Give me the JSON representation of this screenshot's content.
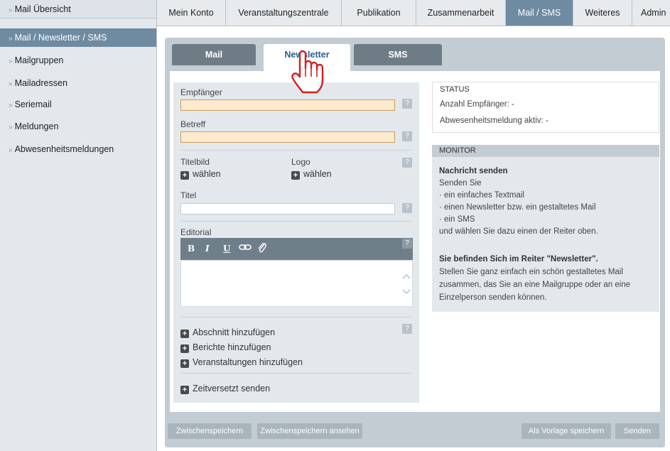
{
  "sidebar": {
    "items": [
      {
        "label": "Mail Übersicht"
      },
      {
        "label": "Mail / Newsletter / SMS"
      },
      {
        "label": "Mailgruppen"
      },
      {
        "label": "Mailadressen"
      },
      {
        "label": "Seriemail"
      },
      {
        "label": "Meldungen"
      },
      {
        "label": "Abwesenheitsmeldungen"
      }
    ],
    "chevron": "»"
  },
  "topnav": {
    "tabs": [
      {
        "label": "Mein Konto"
      },
      {
        "label": "Veranstaltungszentrale"
      },
      {
        "label": "Publikation"
      },
      {
        "label": "Zusammenarbeit"
      },
      {
        "label": "Mail / SMS"
      },
      {
        "label": "Weiteres"
      },
      {
        "label": "Admin"
      }
    ],
    "active": "Mail / SMS"
  },
  "subtabs": [
    {
      "label": "Mail"
    },
    {
      "label": "Newsletter"
    },
    {
      "label": "SMS"
    }
  ],
  "form": {
    "empfaenger_label": "Empfänger",
    "betreff_label": "Betreff",
    "titelbild_label": "Titelbild",
    "logo_label": "Logo",
    "waehlen": "wählen",
    "titel_label": "Titel",
    "editorial_label": "Editorial",
    "help": "?",
    "editor_tools": [
      "B",
      "I",
      "U"
    ],
    "add_items": [
      {
        "label": "Abschnitt hinzufügen"
      },
      {
        "label": "Berichte hinzufügen"
      },
      {
        "label": "Veranstaltungen hinzufügen"
      }
    ],
    "zeitversetzt": "Zeitversetzt senden"
  },
  "status": {
    "title": "STATUS",
    "lines": [
      "Anzahl Empfänger: -",
      "Abwesenheitsmeldung aktiv: -"
    ]
  },
  "monitor": {
    "title": "MONITOR",
    "heading1": "Nachricht senden",
    "lines1": [
      "Senden Sie",
      "· ein einfaches Textmail",
      "· einen Newsletter bzw. ein gestaltetes Mail",
      "· ein SMS",
      "und wählen Sie dazu einen der Reiter oben."
    ],
    "heading2": "Sie befinden Sich im Reiter \"Newsletter\".",
    "lines2": [
      "Stellen Sie ganz einfach ein schön gestaltetes Mail",
      "zusammen, das Sie an eine Mailgruppe oder an eine",
      "Einzelperson senden können."
    ]
  },
  "buttons": {
    "zwischenspeichern": "Zwischenspeichern",
    "ansehen": "Zwischenspeichern ansehen",
    "vorlage": "Als Vorlage speichern",
    "senden": "Senden"
  },
  "colors": {
    "accent": "#6f8ba1",
    "required_field": "#fde9cf"
  },
  "icons": [
    "chevron-right-icon",
    "help-icon",
    "plus-icon",
    "bold-icon",
    "italic-icon",
    "underline-icon",
    "link-icon",
    "attachment-icon",
    "scroll-up-icon",
    "scroll-down-icon",
    "hand-cursor-icon"
  ]
}
